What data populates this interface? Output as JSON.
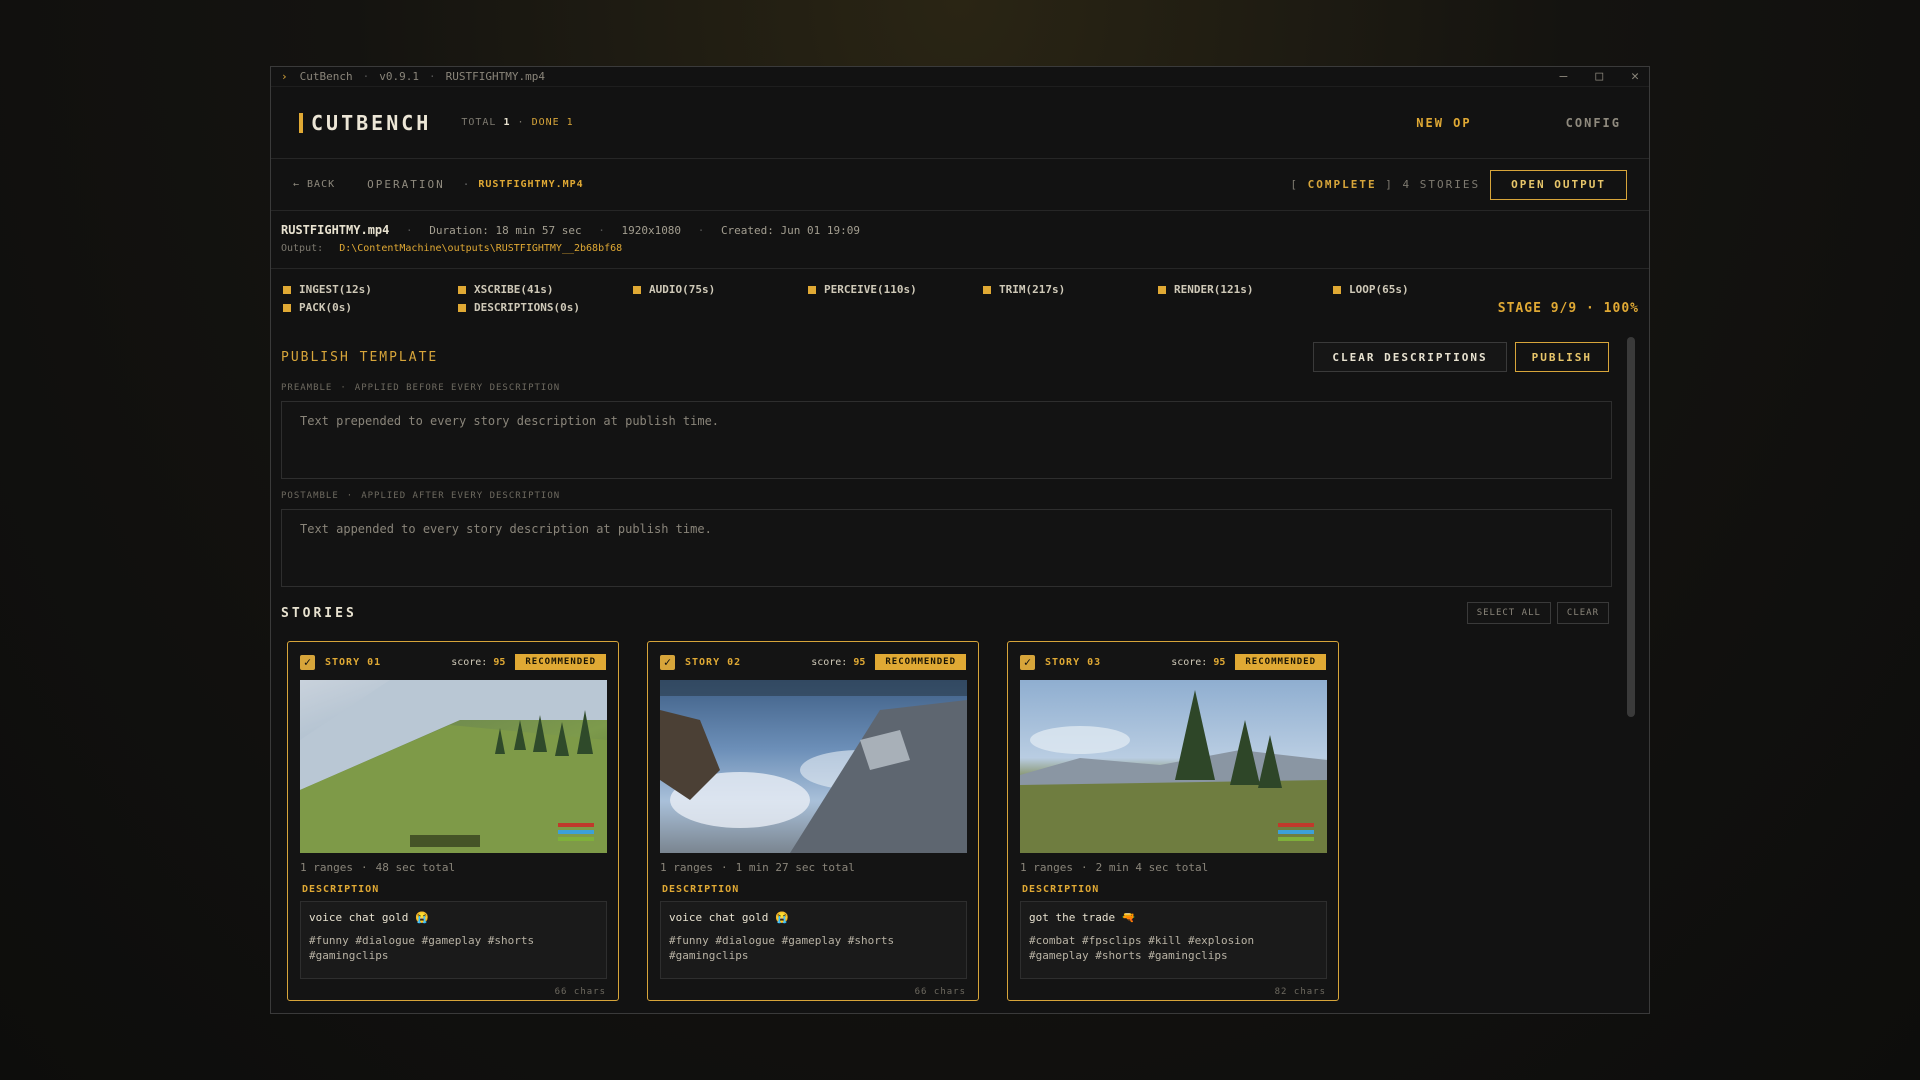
{
  "titlebar": {
    "app": "CutBench",
    "version": "v0.9.1",
    "file": "RUSTFIGHTMY.mp4",
    "minimize": "–",
    "maximize": "□",
    "close": "✕"
  },
  "header": {
    "logo": "CUTBENCH",
    "total_label": "TOTAL",
    "total_value": "1",
    "done_label": "DONE 1",
    "nav_new": "NEW OP",
    "nav_config": "CONFIG"
  },
  "subbar": {
    "back": "← BACK",
    "section": "OPERATION",
    "file": "RUSTFIGHTMY.MP4",
    "status_open": "[",
    "status": "COMPLETE",
    "status_close": "]",
    "stories_count": "4 STORIES",
    "open_output": "OPEN OUTPUT"
  },
  "meta": {
    "filename": "RUSTFIGHTMY.mp4",
    "duration": "Duration: 18 min 57 sec",
    "resolution": "1920x1080",
    "created": "Created: Jun 01 19:09",
    "output_label": "Output:",
    "output_path": "D:\\ContentMachine\\outputs\\RUSTFIGHTMY__2b68bf68"
  },
  "stages": [
    {
      "label": "INGEST(12s)"
    },
    {
      "label": "XSCRIBE(41s)"
    },
    {
      "label": "AUDIO(75s)"
    },
    {
      "label": "PERCEIVE(110s)"
    },
    {
      "label": "TRIM(217s)"
    },
    {
      "label": "RENDER(121s)"
    },
    {
      "label": "LOOP(65s)"
    },
    {
      "label": "PACK(0s)"
    },
    {
      "label": "DESCRIPTIONS(0s)"
    }
  ],
  "stage_progress": "STAGE 9/9 · 100%",
  "publish": {
    "title": "PUBLISH TEMPLATE",
    "clear_descriptions": "CLEAR DESCRIPTIONS",
    "publish": "PUBLISH",
    "preamble_label": "PREAMBLE",
    "preamble_hint": "APPLIED BEFORE EVERY DESCRIPTION",
    "preamble_placeholder": "Text prepended to every story description at publish time.",
    "postamble_label": "POSTAMBLE",
    "postamble_hint": "APPLIED AFTER EVERY DESCRIPTION",
    "postamble_placeholder": "Text appended to every story description at publish time."
  },
  "stories_section": {
    "title": "STORIES",
    "select_all": "SELECT ALL",
    "clear": "CLEAR"
  },
  "stories": [
    {
      "title": "STORY 01",
      "score_label": "score:",
      "score": "95",
      "badge": "RECOMMENDED",
      "ranges": "1 ranges",
      "total": "48 sec total",
      "desc_label": "DESCRIPTION",
      "desc_line": "voice chat gold 😭",
      "tags": "#funny #dialogue #gameplay #shorts #gamingclips",
      "chars": "66 chars",
      "checked": "✓"
    },
    {
      "title": "STORY 02",
      "score_label": "score:",
      "score": "95",
      "badge": "RECOMMENDED",
      "ranges": "1 ranges",
      "total": "1 min 27 sec total",
      "desc_label": "DESCRIPTION",
      "desc_line": "voice chat gold 😭",
      "tags": "#funny #dialogue #gameplay #shorts #gamingclips",
      "chars": "66 chars",
      "checked": "✓"
    },
    {
      "title": "STORY 03",
      "score_label": "score:",
      "score": "95",
      "badge": "RECOMMENDED",
      "ranges": "1 ranges",
      "total": "2 min 4 sec total",
      "desc_label": "DESCRIPTION",
      "desc_line": "got the trade 🔫",
      "tags": "#combat #fpsclips #kill #explosion #gameplay #shorts #gamingclips",
      "chars": "82 chars",
      "checked": "✓"
    }
  ],
  "colors": {
    "accent": "#e0a934",
    "background": "#121212",
    "border": "#3a3a3a"
  }
}
